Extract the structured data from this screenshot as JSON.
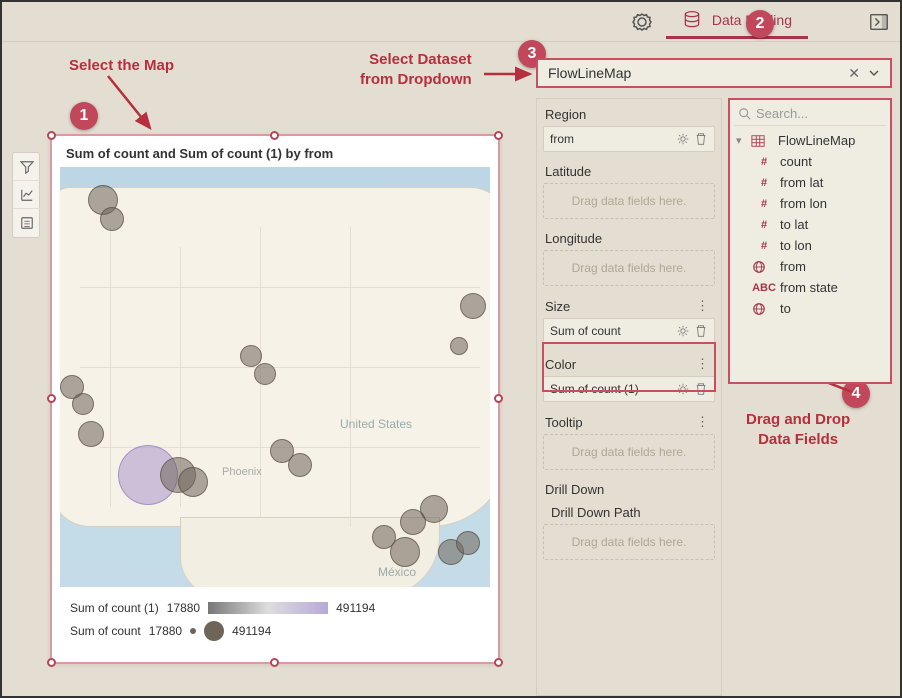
{
  "toolbar": {
    "data_binding_label": "Data Binding"
  },
  "annotations": {
    "step1": "1",
    "step2": "2",
    "step3": "3",
    "step4": "4",
    "select_map": "Select the Map",
    "select_dataset": "Select Dataset\nfrom Dropdown",
    "drag_drop": "Drag and Drop\nData Fields"
  },
  "map": {
    "title": "Sum of count and Sum of count (1) by from",
    "country_label": "United States",
    "city_label": "Phoenix",
    "mexico_label": "México"
  },
  "legend": {
    "row1_name": "Sum of count (1)",
    "row1_min": "17880",
    "row1_max": "491194",
    "row2_name": "Sum of count",
    "row2_min": "17880",
    "row2_max": "491194"
  },
  "dataset": {
    "selected": "FlowLineMap"
  },
  "binding": {
    "region": {
      "label": "Region",
      "value": "from"
    },
    "latitude": {
      "label": "Latitude",
      "placeholder": "Drag data fields here."
    },
    "longitude": {
      "label": "Longitude",
      "placeholder": "Drag data fields here."
    },
    "size": {
      "label": "Size",
      "value": "Sum of count"
    },
    "color": {
      "label": "Color",
      "value": "Sum of count (1)"
    },
    "tooltip": {
      "label": "Tooltip",
      "placeholder": "Drag data fields here."
    },
    "drill": {
      "label": "Drill Down",
      "sublabel": "Drill Down Path",
      "placeholder": "Drag data fields here."
    }
  },
  "tree": {
    "search_placeholder": "Search...",
    "table": "FlowLineMap",
    "fields": [
      {
        "type": "#",
        "name": "count"
      },
      {
        "type": "#",
        "name": "from lat"
      },
      {
        "type": "#",
        "name": "from lon"
      },
      {
        "type": "#",
        "name": "to lat"
      },
      {
        "type": "#",
        "name": "to lon"
      },
      {
        "type": "globe",
        "name": "from"
      },
      {
        "type": "ABC",
        "name": "from state"
      },
      {
        "type": "globe",
        "name": "to"
      }
    ]
  }
}
